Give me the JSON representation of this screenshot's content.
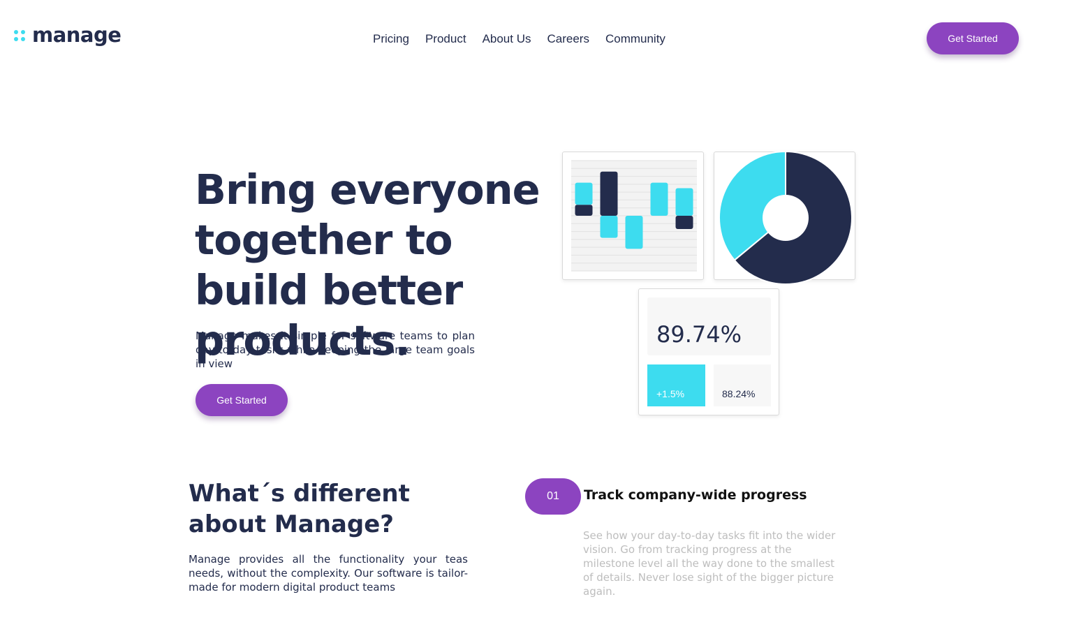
{
  "brand": {
    "name": "manage",
    "accent": "#8c44c0",
    "cyan": "#3ddcef",
    "navy": "#232c4c"
  },
  "nav": {
    "items": [
      "Pricing",
      "Product",
      "About Us",
      "Careers",
      "Community"
    ],
    "cta_label": "Get Started"
  },
  "hero": {
    "title": "Bring everyone together to build better products.",
    "text": "Manage makes it simple for software teams to plan day-to-day tasks while keeping the large team goals in view",
    "cta_label": "Get Started"
  },
  "stats": {
    "main_value": "89.74%",
    "change_value": "+1.5%",
    "secondary_value": "88.24%"
  },
  "chart_data": [
    {
      "type": "bar",
      "series": [
        {
          "name": "",
          "values": [
            1.0,
            4.0,
            0,
            0,
            -1.2
          ],
          "color": "#232c4c"
        },
        {
          "name": "",
          "values": [
            2.0,
            -2.0,
            -3.0,
            3.0,
            2.5
          ],
          "color": "#3ddcef"
        }
      ],
      "categories": [
        "",
        "",
        "",
        "",
        ""
      ],
      "title": "",
      "xlabel": "",
      "ylabel": "",
      "grid": true
    },
    {
      "type": "pie",
      "slices": [
        {
          "label": "",
          "value": 64,
          "color": "#232c4c"
        },
        {
          "label": "",
          "value": 36,
          "color": "#3ddcef"
        }
      ],
      "title": ""
    }
  ],
  "section": {
    "title": "What´s different about Manage?",
    "text": "Manage provides all the functionality your teas needs, without the complexity. Our software is tailor-made for modern digital product teams"
  },
  "feature": {
    "number": "01",
    "title": "Track company-wide progress",
    "text": "See how your day-to-day tasks fit into the wider vision. Go from tracking progress at the milestone level all the way done to the smallest of details. Never lose sight of the bigger picture again."
  }
}
